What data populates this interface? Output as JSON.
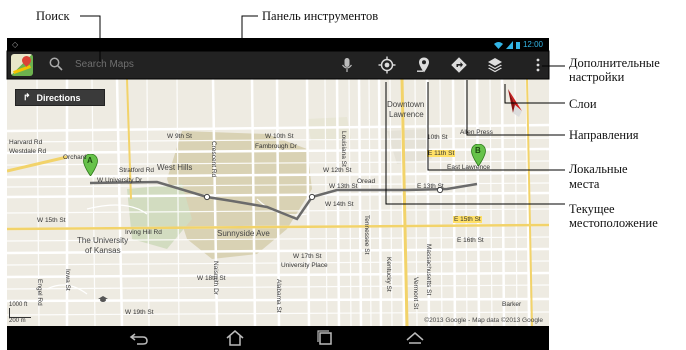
{
  "callouts": {
    "search": "Поиск",
    "toolbar": "Панель инструментов",
    "more_settings_1": "Дополнительные",
    "more_settings_2": "настройки",
    "layers": "Слои",
    "directions": "Направления",
    "local_1": "Локальные",
    "local_2": "места",
    "my_location_1": "Текущее",
    "my_location_2": "местоположение"
  },
  "statusbar": {
    "time": "12:00"
  },
  "toolbar": {
    "search_placeholder": "Search Maps"
  },
  "map": {
    "directions_label": "Directions",
    "copyright": "©2013 Google - Map data ©2013 Google",
    "scale_ft": "1000 ft",
    "scale_m": "200 m",
    "markers": {
      "a": "A",
      "b": "B"
    },
    "labels": {
      "downtown": "Downtown",
      "lawrence": "Lawrence",
      "harvard_rd": "Harvard Rd",
      "westdale_rd": "Westdale Rd",
      "orchard": "Orchard",
      "stratford_rd": "Stratford Rd",
      "university_dr": "W University Dr",
      "west_hills": "West Hills",
      "w10th": "W 10th St",
      "fambrough": "Fambrough Dr",
      "w9th": "W 9th St",
      "tenth": "10th St",
      "allen_press": "Allen Press",
      "e11th": "E 11th St",
      "e13th": "E 13th St",
      "east_lawrence": "East Lawrence",
      "w12th": "W 12th St",
      "w13th": "W 13th St",
      "w14th": "W 14th St",
      "e15th": "E 15th St",
      "e16th": "E 16th St",
      "w15th": "W 15th St",
      "irving_hill": "Irving Hill Rd",
      "university_kansas_1": "The University",
      "university_kansas_2": "of Kansas",
      "sunnyside": "Sunnyside Ave",
      "w17th": "W 17th St",
      "university_place": "University Place",
      "w18th": "W 18th St",
      "w19th": "W 19th St",
      "barker": "Barker",
      "oread": "Oread",
      "crescent_rd": "Crescent Rd",
      "naismith": "Naismith Dr",
      "alabama": "Alabama St",
      "kentucky": "Kentucky St",
      "mass": "Massachusetts St",
      "vermont": "Vermont St",
      "louisiana": "Louisiana St",
      "iowa": "Iowa St",
      "engel": "Engel Rd",
      "tennessee": "Tennessee St"
    }
  }
}
